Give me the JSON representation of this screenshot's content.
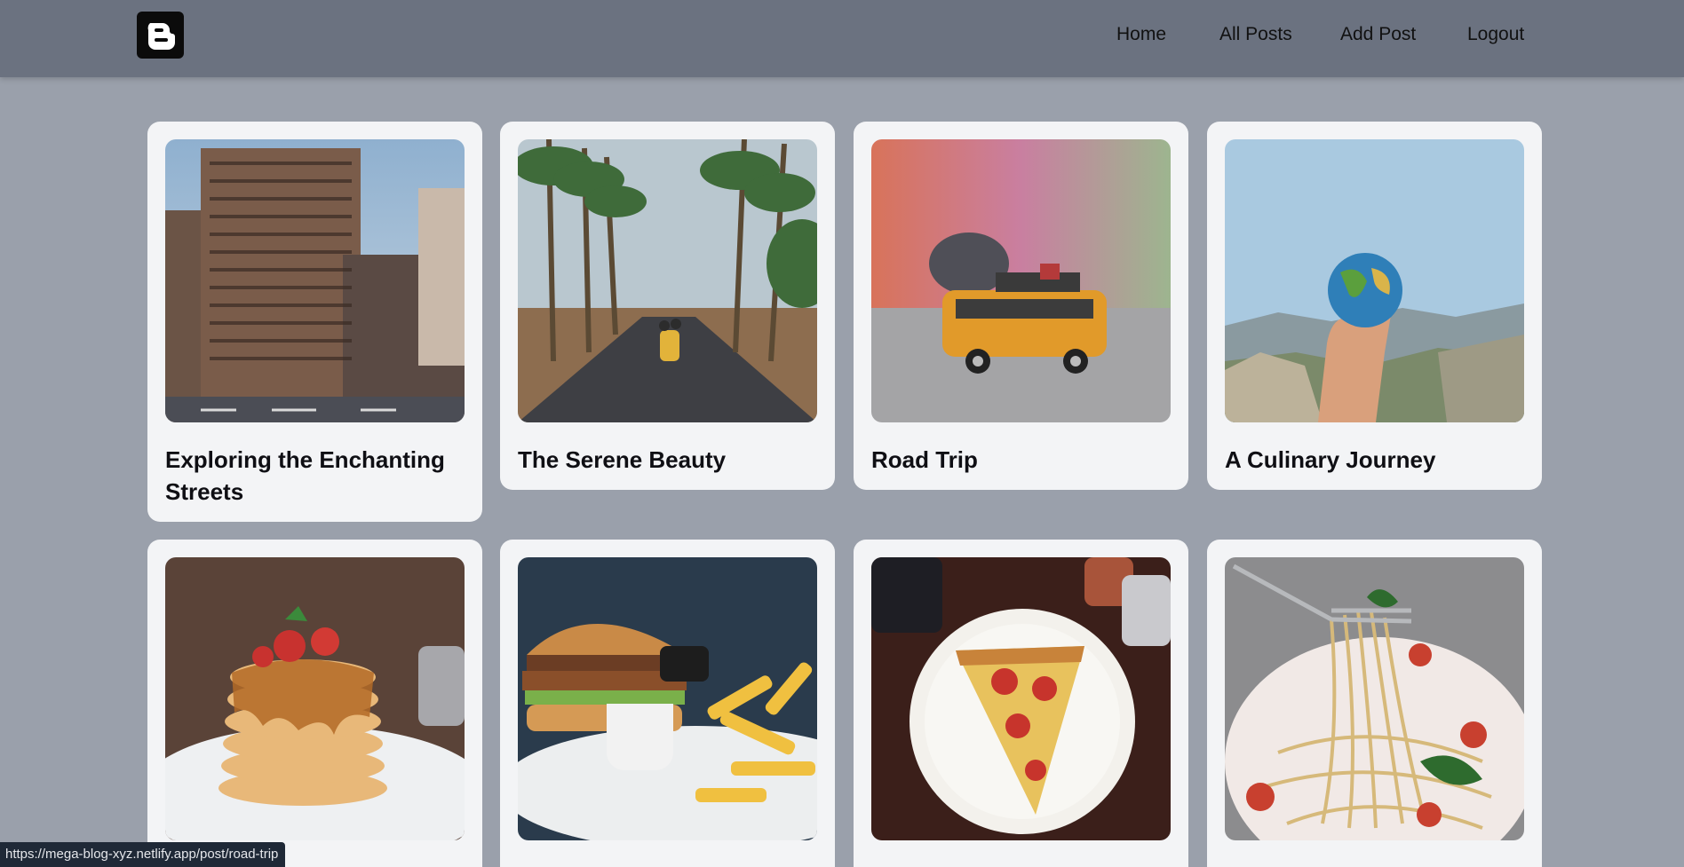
{
  "navbar": {
    "logo_icon": "blogger-b-icon",
    "links": [
      {
        "label": "Home"
      },
      {
        "label": "All Posts"
      },
      {
        "label": "Add Post"
      },
      {
        "label": "Logout"
      }
    ]
  },
  "posts": [
    {
      "title": "Exploring the Enchanting Streets",
      "image": "city-buildings-photo"
    },
    {
      "title": "The Serene Beauty",
      "image": "palm-road-scooter-photo"
    },
    {
      "title": "Road Trip",
      "image": "toy-van-photo"
    },
    {
      "title": "A Culinary Journey",
      "image": "hand-globe-photo"
    },
    {
      "title": "",
      "image": "pancakes-photo"
    },
    {
      "title": "",
      "image": "burger-fries-photo"
    },
    {
      "title": "",
      "image": "pizza-slice-photo"
    },
    {
      "title": "",
      "image": "spaghetti-photo"
    }
  ],
  "status_bar": {
    "url": "https://mega-blog-xyz.netlify.app/post/road-trip"
  }
}
